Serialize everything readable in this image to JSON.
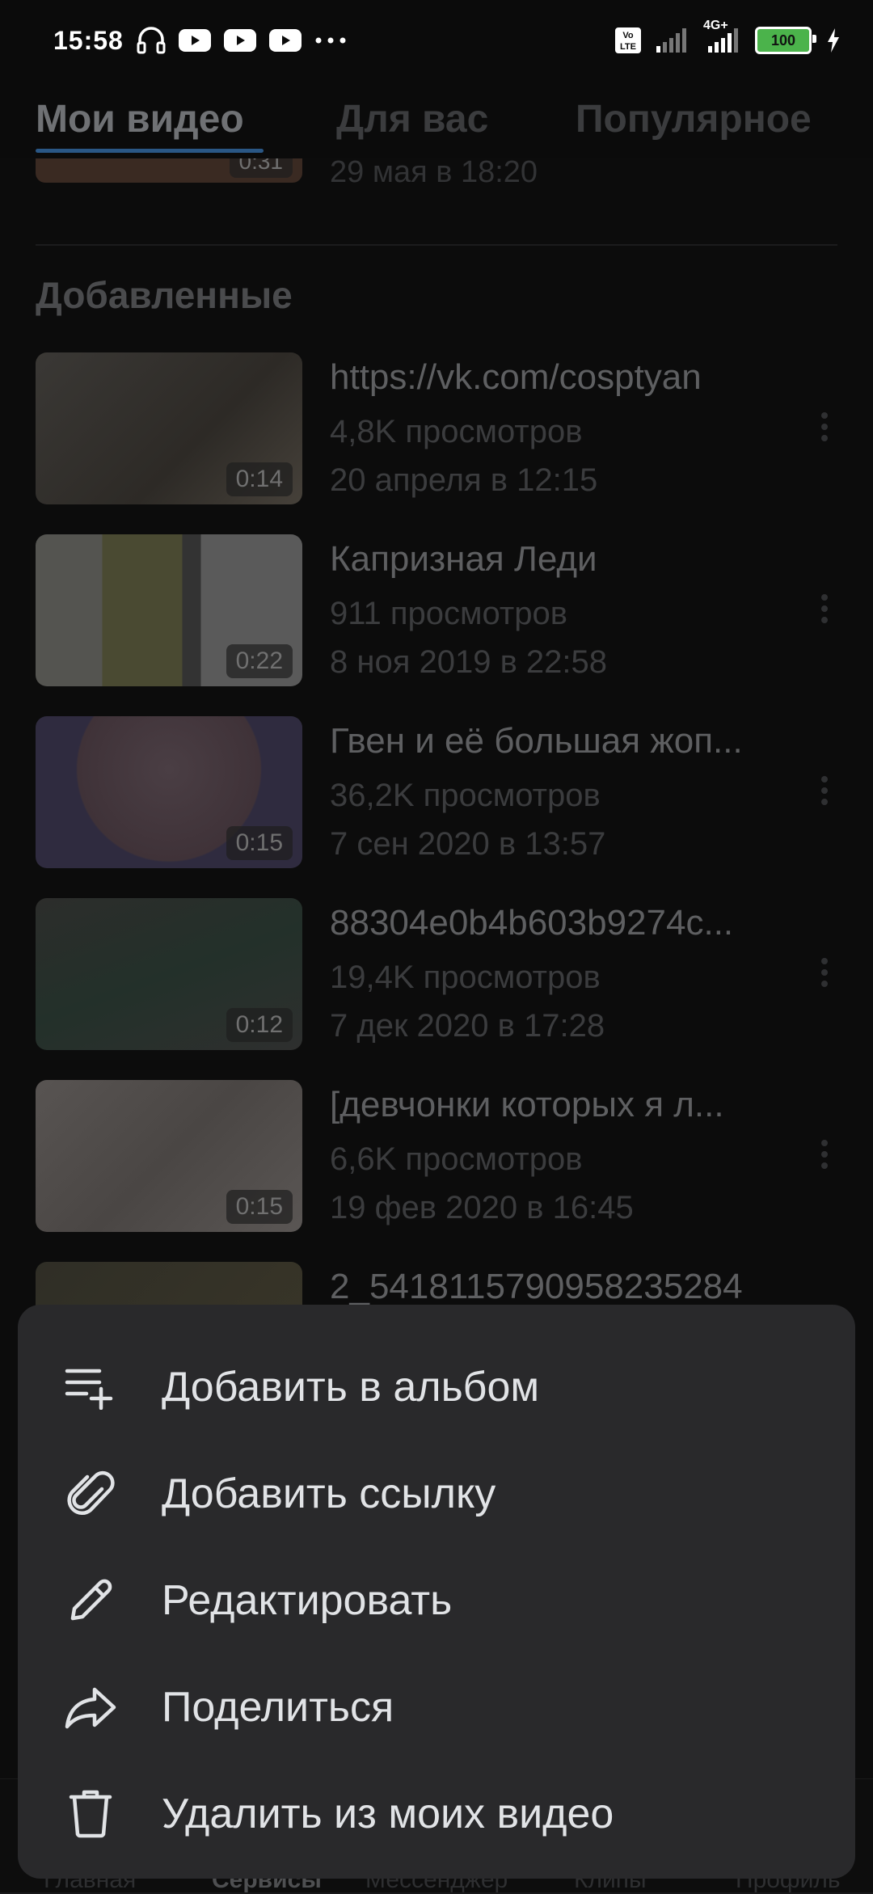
{
  "status_bar": {
    "time": "15:58",
    "icons": [
      "headphones-icon",
      "youtube-icon",
      "youtube-icon",
      "youtube-icon",
      "more-dots-icon"
    ],
    "network_label": "4G+",
    "volte_label": "Vo LTE",
    "battery": "100"
  },
  "tabs": [
    {
      "label": "Мои видео",
      "active": true
    },
    {
      "label": "Для вас",
      "active": false
    },
    {
      "label": "Популярное",
      "active": false
    }
  ],
  "previous_item": {
    "duration": "0:31",
    "date": "29 мая в 18:20"
  },
  "section_title": "Добавленные",
  "videos": [
    {
      "title": "https://vk.com/cosptyan",
      "views": "4,8K просмотров",
      "date": "20 апреля в 12:15",
      "duration": "0:14",
      "thumb_color": "#3c3a36"
    },
    {
      "title": "Капризная Леди",
      "views": "911 просмотров",
      "date": "8 ноя 2019 в 22:58",
      "duration": "0:22",
      "thumb_color": "#4e4e4a"
    },
    {
      "title": "Гвен и её большая жоп...",
      "views": "36,2K просмотров",
      "date": "7 сен 2020 в 13:57",
      "duration": "0:15",
      "thumb_color": "#473a40"
    },
    {
      "title": "88304e0b4b603b9274c...",
      "views": "19,4K просмотров",
      "date": "7 дек 2020 в 17:28",
      "duration": "0:12",
      "thumb_color": "#2a302c"
    },
    {
      "title": "[девчонки которых я л...",
      "views": "6,6K просмотров",
      "date": "19 фев 2020 в 16:45",
      "duration": "0:15",
      "thumb_color": "#4f4b48"
    },
    {
      "title": "2_5418115790958235284",
      "views": "",
      "date": "",
      "duration": "",
      "thumb_color": "#2f2e26"
    }
  ],
  "bottom_nav": [
    {
      "label": "Главная",
      "active": false
    },
    {
      "label": "Сервисы",
      "active": true
    },
    {
      "label": "Мессенджер",
      "active": false
    },
    {
      "label": "Клипы",
      "active": false
    },
    {
      "label": "Профиль",
      "active": false
    }
  ],
  "menu": [
    {
      "label": "Добавить в альбом",
      "icon": "add-to-list-icon"
    },
    {
      "label": "Добавить ссылку",
      "icon": "paperclip-icon"
    },
    {
      "label": "Редактировать",
      "icon": "pencil-icon"
    },
    {
      "label": "Поделиться",
      "icon": "share-arrow-icon"
    },
    {
      "label": "Удалить из моих видео",
      "icon": "trash-icon"
    }
  ],
  "colors": {
    "background": "#0c0c0c",
    "sheet": "#29292b",
    "tab_underline": "#2a5785",
    "battery_fill": "#4bb34b"
  }
}
